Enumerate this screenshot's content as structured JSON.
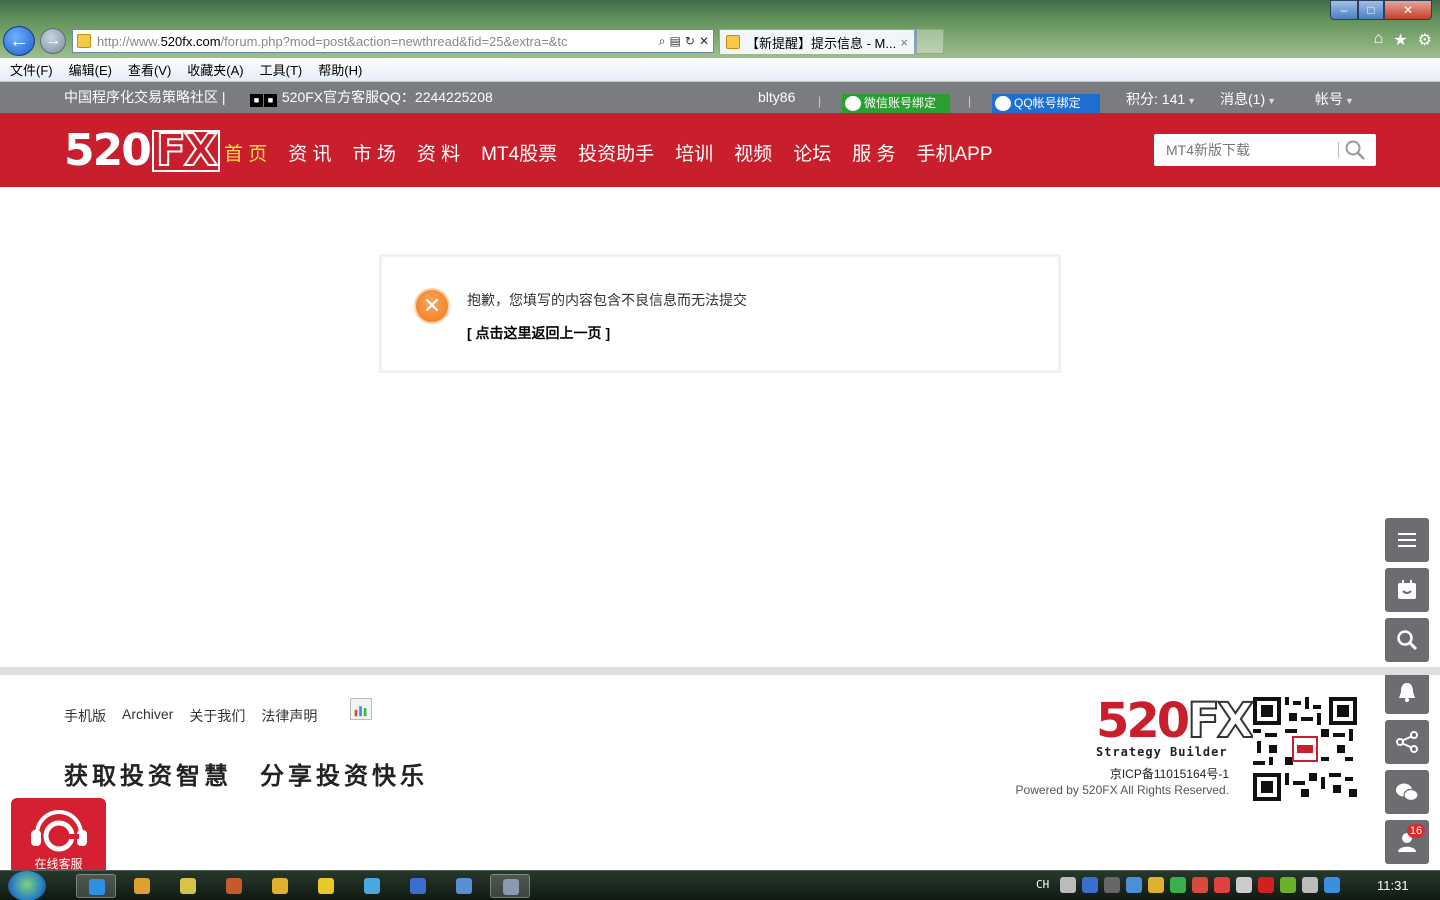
{
  "browser": {
    "url_prefix": "http://www.",
    "url_domain": "520fx.com",
    "url_rest": "/forum.php?mod=post&action=newthread&fid=25&extra=&tc",
    "tab_title": "【新提醒】提示信息 - M...",
    "tab_close": "×",
    "menu": [
      "文件(F)",
      "编辑(E)",
      "查看(V)",
      "收藏夹(A)",
      "工具(T)",
      "帮助(H)"
    ]
  },
  "topbar": {
    "community": "中国程序化交易策略社区 |",
    "qq_service": "520FX官方客服QQ：2244225208",
    "username": "blty86",
    "wechat_bind": "微信账号绑定",
    "qq_bind": "QQ帐号绑定",
    "points": "积分: 141",
    "messages": "消息(1)",
    "account": "帐号"
  },
  "header": {
    "logo_main": "520",
    "logo_fx": "FX",
    "nav": [
      "首 页",
      "资 讯",
      "市 场",
      "资 料",
      "MT4股票",
      "投资助手",
      "培训",
      "视频",
      "论坛",
      "服 务",
      "手机APP"
    ],
    "search_placeholder": "MT4新版下载"
  },
  "message": {
    "icon": "✕",
    "text": "抱歉，您填写的内容包含不良信息而无法提交",
    "back_link": "[ 点击这里返回上一页 ]"
  },
  "floatbar": {
    "badge_count": "16"
  },
  "footer": {
    "links": [
      "手机版",
      "Archiver",
      "关于我们",
      "法律声明"
    ],
    "slogan": "获取投资智慧　分享投资快乐",
    "logo_main": "520",
    "logo_fx": "FX",
    "logo_sub": "Strategy Builder",
    "icp": "京ICP备11015164号-1",
    "powered": "Powered by 520FX All Rights Reserved."
  },
  "online_service": {
    "label": "在线客服"
  },
  "taskbar": {
    "lang": "CH",
    "clock": "11:31"
  },
  "colors": {
    "header_red": "#c91f2c",
    "nav_active": "#ffdd4a",
    "topbar_gray": "#7b7c80"
  }
}
